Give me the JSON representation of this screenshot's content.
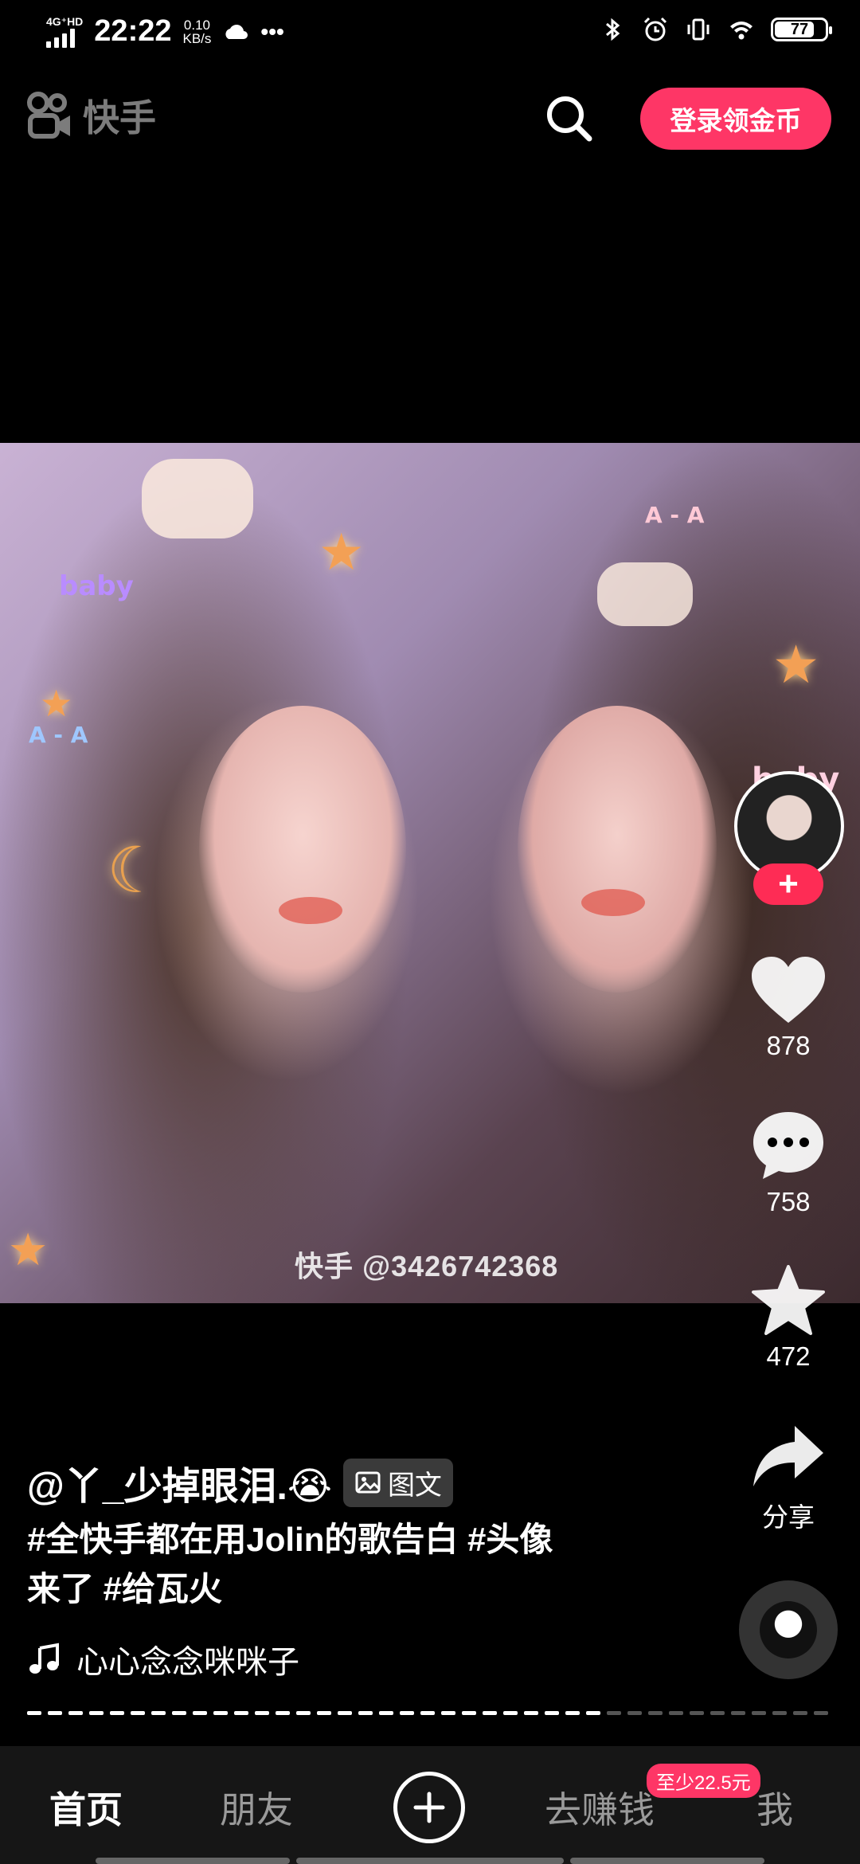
{
  "status_bar": {
    "network": "4G⁺HD",
    "time": "22:22",
    "speed_value": "0.10",
    "speed_unit": "KB/s",
    "more": "•••",
    "battery": "77"
  },
  "header": {
    "app_name": "快手",
    "login_button": "登录领金币"
  },
  "video": {
    "watermark": "快手 @3426742368",
    "sticker_baby_1": "baby",
    "sticker_baby_2": "baby",
    "sticker_aa_1": "A - A",
    "sticker_aa_2": "A - A"
  },
  "rail": {
    "follow": "+",
    "likes": "878",
    "comments": "758",
    "favorites": "472",
    "share": "分享"
  },
  "post": {
    "author": "@丫_少掉眼泪.😭",
    "type_chip": "图文",
    "caption_line1": "#全快手都在用Jolin的歌告白 #头像",
    "caption_line2": "来了 #给瓦火",
    "music": "心心念念咪咪子",
    "progress_fraction": 0.71
  },
  "nav": {
    "home": "首页",
    "friends": "朋友",
    "earn": "去赚钱",
    "earn_badge": "至少22.5元",
    "me": "我"
  },
  "colors": {
    "accent": "#fe3666",
    "background": "#000000"
  }
}
